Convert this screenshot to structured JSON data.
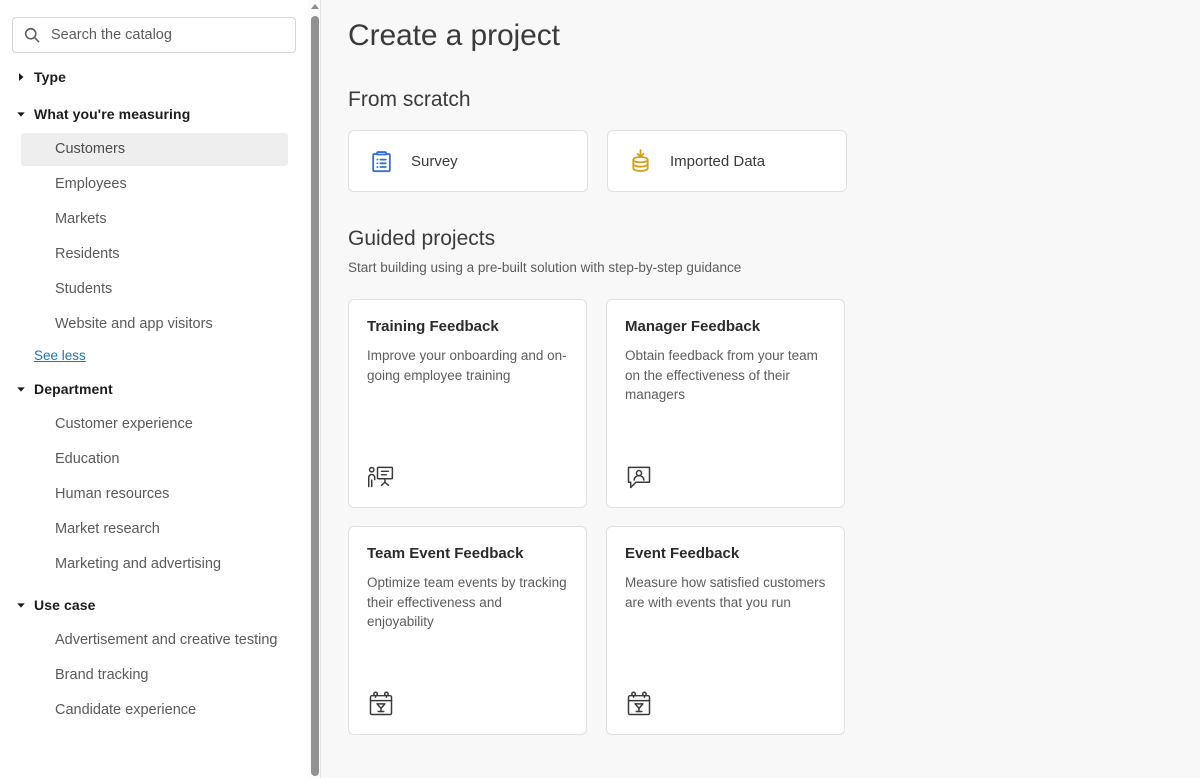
{
  "search": {
    "placeholder": "Search the catalog",
    "value": "",
    "icon": "search-icon"
  },
  "sidebar": {
    "facets": [
      {
        "title": "Type",
        "expanded": false,
        "caret": "chevron-right-icon",
        "items": [],
        "see_link": null
      },
      {
        "title": "What you're measuring",
        "expanded": true,
        "caret": "chevron-down-icon",
        "items": [
          {
            "label": "Customers",
            "selected": true
          },
          {
            "label": "Employees",
            "selected": false
          },
          {
            "label": "Markets",
            "selected": false
          },
          {
            "label": "Residents",
            "selected": false
          },
          {
            "label": "Students",
            "selected": false
          },
          {
            "label": "Website and app visitors",
            "selected": false
          }
        ],
        "see_link": "See less"
      },
      {
        "title": "Department",
        "expanded": true,
        "caret": "chevron-down-icon",
        "items": [
          {
            "label": "Customer experience",
            "selected": false
          },
          {
            "label": "Education",
            "selected": false
          },
          {
            "label": "Human resources",
            "selected": false
          },
          {
            "label": "Market research",
            "selected": false
          },
          {
            "label": "Marketing and advertising",
            "selected": false
          }
        ],
        "see_link": null
      },
      {
        "title": "Use case",
        "expanded": true,
        "caret": "chevron-down-icon",
        "items": [
          {
            "label": "Advertisement and creative testing",
            "selected": false
          },
          {
            "label": "Brand tracking",
            "selected": false
          },
          {
            "label": "Candidate experience",
            "selected": false
          }
        ],
        "see_link": null
      }
    ],
    "scrollbar": {
      "up_arrow_icon": "triangle-up-icon",
      "thumb": "scrollbar-thumb"
    }
  },
  "main": {
    "page_title": "Create a project",
    "from_scratch": {
      "heading": "From scratch",
      "tiles": [
        {
          "label": "Survey",
          "icon": "clipboard-list-icon",
          "color": "#3a6fd8"
        },
        {
          "label": "Imported Data",
          "icon": "database-download-icon",
          "color": "#d4a017"
        }
      ]
    },
    "guided": {
      "heading": "Guided projects",
      "subheading": "Start building using a pre-built solution with step-by-step guidance",
      "cards": [
        {
          "title": "Training Feedback",
          "description": "Improve your onboarding and on-going employee training",
          "icon": "presenter-whiteboard-icon"
        },
        {
          "title": "Manager Feedback",
          "description": "Obtain feedback from your team on the effectiveness of their managers",
          "icon": "person-speech-bubble-icon"
        },
        {
          "title": "Team Event Feedback",
          "description": "Optimize team events by tracking their effectiveness and enjoyability",
          "icon": "calendar-event-icon"
        },
        {
          "title": "Event Feedback",
          "description": "Measure how satisfied customers are with events that you run",
          "icon": "calendar-event-icon"
        }
      ]
    }
  },
  "colors": {
    "page_background": "#f8f8f8",
    "sidebar_background": "#ffffff",
    "card_background": "#ffffff",
    "selected_item": "#eeeeee",
    "link": "#1f73b7",
    "survey_icon": "#3a6fd8",
    "imported_data_icon": "#d4a017"
  }
}
